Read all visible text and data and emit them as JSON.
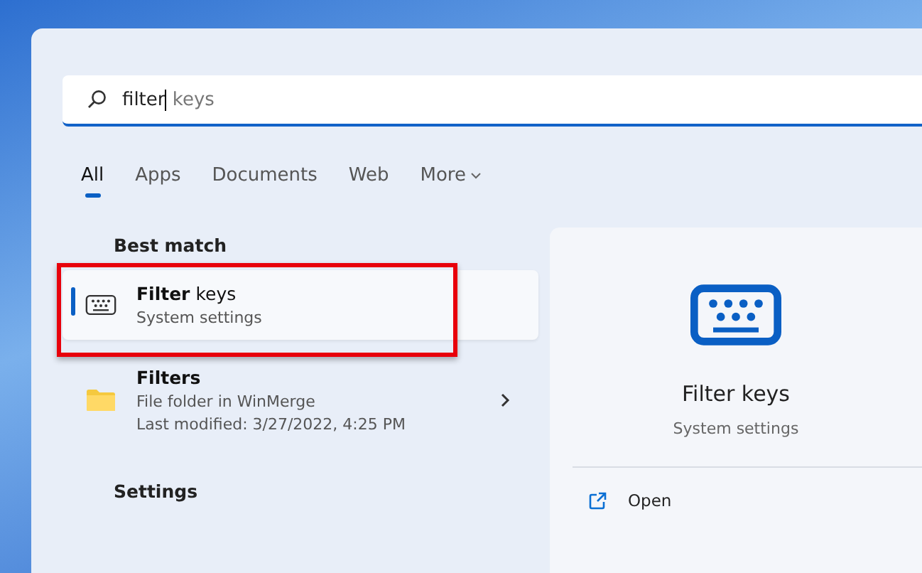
{
  "search": {
    "typed": "filter",
    "suggestion": " keys"
  },
  "tabs": [
    {
      "label": "All",
      "selected": true,
      "kind": "tab"
    },
    {
      "label": "Apps",
      "selected": false,
      "kind": "tab"
    },
    {
      "label": "Documents",
      "selected": false,
      "kind": "tab"
    },
    {
      "label": "Web",
      "selected": false,
      "kind": "tab"
    },
    {
      "label": "More",
      "selected": false,
      "kind": "menu"
    }
  ],
  "best_match": {
    "heading": "Best match",
    "results": [
      {
        "kind": "setting",
        "title": "**Filter** keys",
        "subtitle": "System settings",
        "selected": true,
        "highlighted": true
      }
    ]
  },
  "results": [
    {
      "kind": "folder",
      "title": "**Filters**",
      "lines": [
        "File folder in WinMerge",
        "Last modified: 3/27/2022, 4:25 PM"
      ],
      "selected": false,
      "highlighted": false
    }
  ],
  "settings_heading": "Settings",
  "preview": {
    "title": "Filter keys",
    "subtitle": "System settings",
    "actions": [
      {
        "label": "Open"
      }
    ]
  }
}
